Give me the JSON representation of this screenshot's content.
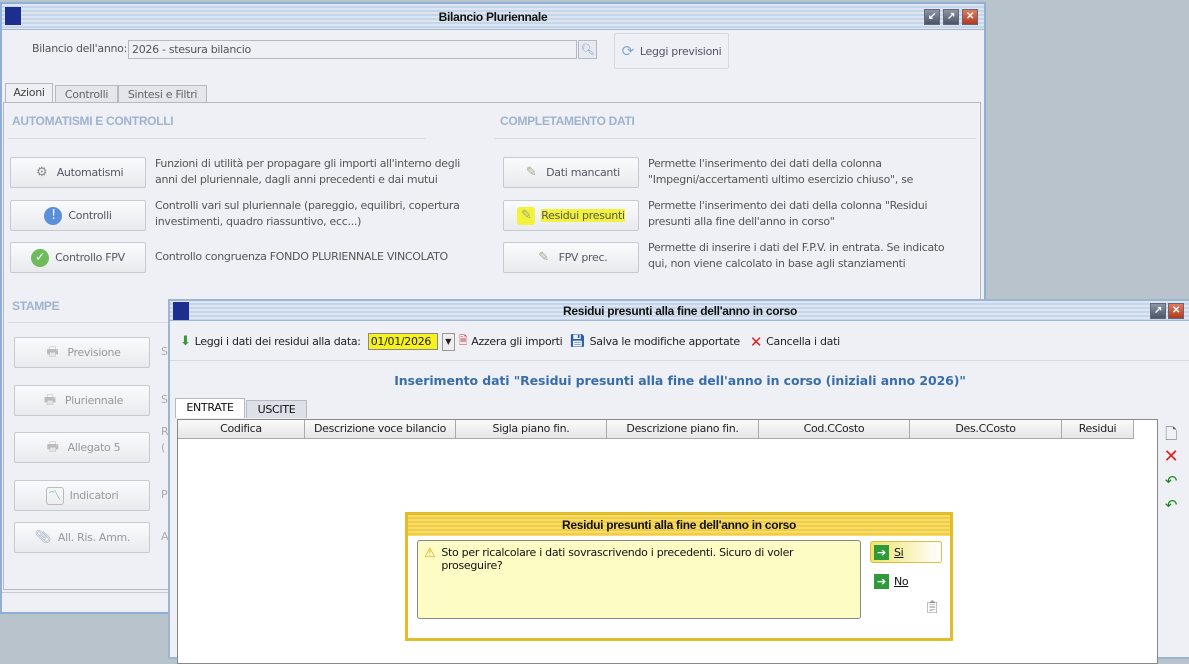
{
  "main_window": {
    "title": "Bilancio Pluriennale",
    "year_label": "Bilancio dell'anno:",
    "year_value": "2026 - stesura bilancio",
    "read_button": "Leggi previsioni",
    "tabs": [
      "Azioni",
      "Controlli",
      "Sintesi e Filtri"
    ],
    "section_left": "AUTOMATISMI E CONTROLLI",
    "section_right": "COMPLETAMENTO DATI",
    "section_print": "STAMPE",
    "left_actions": [
      {
        "label": "Automatismi",
        "desc": "Funzioni di utilità per propagare gli importi all'interno degli anni del pluriennale, dagli anni precedenti e dai mutui"
      },
      {
        "label": "Controlli",
        "desc": "Controlli vari sul pluriennale (pareggio, equilibri, copertura investimenti, quadro riassuntivo, ecc...)"
      },
      {
        "label": "Controllo FPV",
        "desc": "Controllo congruenza FONDO PLURIENNALE VINCOLATO"
      }
    ],
    "right_actions": [
      {
        "label": "Dati mancanti",
        "desc": "Permette l'inserimento dei dati della colonna \"Impegni/accertamenti ultimo esercizio chiuso\", se"
      },
      {
        "label": "Residui presunti",
        "desc": "Permette l'inserimento dei dati della colonna \"Residui presunti alla fine dell'anno in corso\""
      },
      {
        "label": "FPV prec.",
        "desc": "Permette di inserire i dati del F.P.V. in entrata. Se indicato qui, non viene calcolato in base agli stanziamenti"
      }
    ],
    "print_actions": [
      {
        "label": "Previsione",
        "desc": "S"
      },
      {
        "label": "Pluriennale",
        "desc": "S"
      },
      {
        "label": "Allegato 5",
        "desc": "R ("
      },
      {
        "label": "Indicatori",
        "desc": "P"
      },
      {
        "label": "All. Ris. Amm.",
        "desc": "A"
      }
    ]
  },
  "residui_window": {
    "title": "Residui presunti alla fine dell'anno in corso",
    "toolbar": {
      "read_label": "Leggi i dati dei residui alla data:",
      "date_value": "01/01/2026",
      "reset": "Azzera gli importi",
      "save": "Salva le modifiche apportate",
      "delete": "Cancella i dati"
    },
    "subtitle": "Inserimento dati \"Residui presunti alla fine dell'anno in corso (iniziali anno 2026)\"",
    "tabs": [
      "ENTRATE",
      "USCITE"
    ],
    "columns": [
      "Codifica",
      "Descrizione voce bilancio",
      "Sigla piano fin.",
      "Descrizione piano fin.",
      "Cod.CCosto",
      "Des.CCosto",
      "Residui"
    ]
  },
  "dialog": {
    "title": "Residui presunti alla fine dell'anno in corso",
    "message": "Sto per ricalcolare i dati sovrascrivendo i precedenti. Sicuro di voler proseguire?",
    "yes": "Si",
    "no": "No"
  }
}
